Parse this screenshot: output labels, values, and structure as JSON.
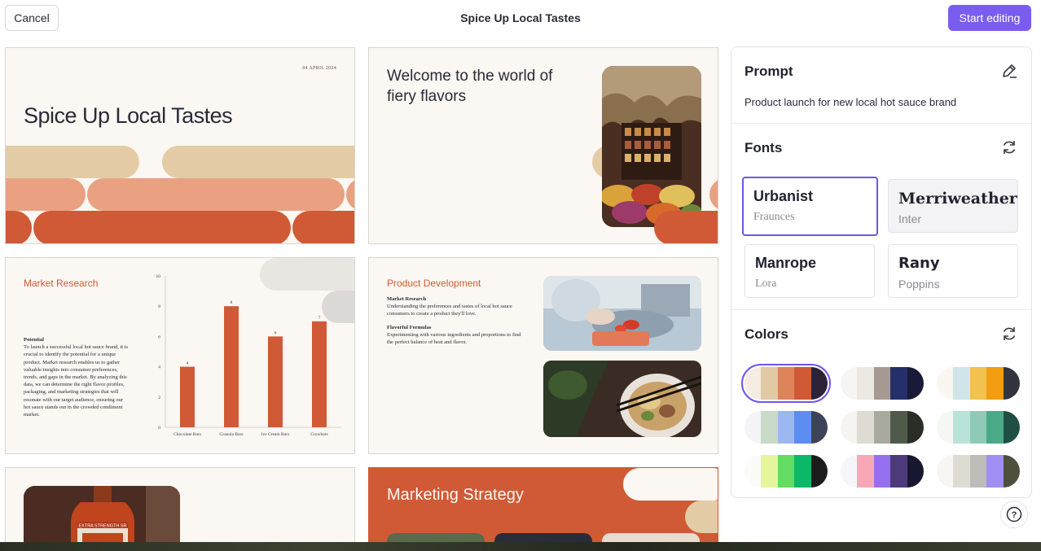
{
  "header": {
    "cancel_label": "Cancel",
    "title": "Spice Up Local Tastes",
    "start_label": "Start editing"
  },
  "slides": {
    "s1": {
      "date": "04 APRIL 2024",
      "title": "Spice Up Local Tastes"
    },
    "s2": {
      "title": "Welcome to the world of fiery flavors"
    },
    "s3": {
      "title": "Market Research",
      "heading": "Potential",
      "body": "To launch a successful local hot sauce brand, it is crucial to identify the potential for a unique product. Market research enables us to gather valuable insights into consumer preferences, trends, and gaps in the market. By analyzing this data, we can determine the right flavor profiles, packaging, and marketing strategies that will resonate with our target audience, ensuring our hot sauce stands out in the crowded condiment market."
    },
    "s4": {
      "title": "Product Development",
      "h1": "Market Research",
      "p1": "Understanding the preferences and tastes of local hot sauce consumers to create a product they'll love.",
      "h2": "Flavorful Formulas",
      "p2": "Experimenting with various ingredients and proportions to find the perfect balance of heat and flavor."
    },
    "s5": {
      "bottle_label": "EXTRA STRENGTH SR"
    },
    "s6": {
      "title": "Marketing Strategy"
    }
  },
  "chart_data": {
    "type": "bar",
    "categories": [
      "Chocolate Bars",
      "Granola Bars",
      "Ice Cream Bars",
      "Crowbars"
    ],
    "values": [
      4,
      8,
      6,
      7
    ],
    "ylim": [
      0,
      10
    ],
    "yticks": [
      0,
      2,
      4,
      6,
      8,
      10
    ],
    "color": "#d05a36"
  },
  "panel": {
    "prompt_title": "Prompt",
    "prompt_text": "Product launch for new local hot sauce brand",
    "fonts_title": "Fonts",
    "fonts": [
      {
        "main": "Urbanist",
        "sub": "Fraunces"
      },
      {
        "main": "Merriweather",
        "sub": "Inter"
      },
      {
        "main": "Manrope",
        "sub": "Lora"
      },
      {
        "main": "Rany",
        "sub": "Poppins"
      }
    ],
    "colors_title": "Colors",
    "palettes": [
      [
        "#f5ede4",
        "#e0c9a3",
        "#e0825a",
        "#d05a36",
        "#2e2236"
      ],
      [
        "#f6f5f3",
        "#ece8e2",
        "#a49a92",
        "#25306a",
        "#181a38"
      ],
      [
        "#faf6f0",
        "#cfe5ea",
        "#f2c14e",
        "#f29d0f",
        "#34343e"
      ],
      [
        "#f4f4f6",
        "#c9d9c7",
        "#9cb8f0",
        "#5b8ef0",
        "#3d4358"
      ],
      [
        "#f5f4f1",
        "#dedbd2",
        "#a9aa9e",
        "#4f5a4b",
        "#2b2d28"
      ],
      [
        "#f5f7f5",
        "#b9e3d8",
        "#8fcab7",
        "#4aaa87",
        "#1f4f43"
      ],
      [
        "#fbfbf8",
        "#e5f59e",
        "#64dc64",
        "#0bb86a",
        "#1c1c1c"
      ],
      [
        "#f6f6fa",
        "#f7a8b6",
        "#9470ee",
        "#4d3a7a",
        "#171830"
      ],
      [
        "#f7f6f2",
        "#dedcd2",
        "#bdbcb8",
        "#a08ef2",
        "#4e4f3d"
      ]
    ]
  },
  "help_label": "?"
}
